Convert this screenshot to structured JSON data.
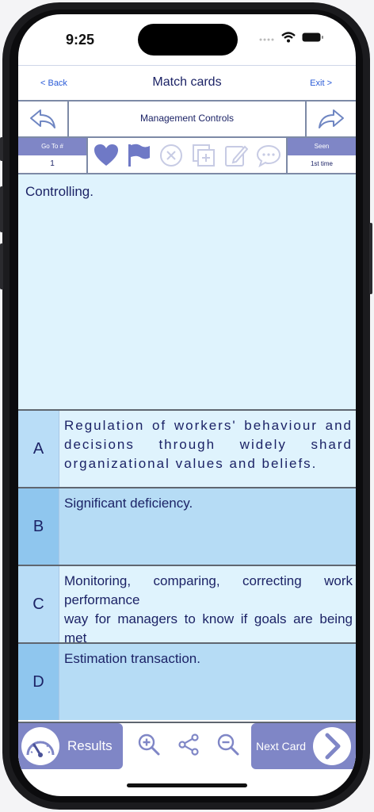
{
  "status_bar": {
    "time": "9:25"
  },
  "nav": {
    "back_label": "< Back",
    "title": "Match cards",
    "exit_label": "Exit >"
  },
  "topic": {
    "title": "Management Controls"
  },
  "goto": {
    "header": "Go To #",
    "value": "1"
  },
  "seen": {
    "header": "Seen",
    "value": "1st time"
  },
  "toolbar_icons": [
    "heart-icon",
    "flag-icon",
    "close-circle-icon",
    "add-note-icon",
    "edit-icon",
    "chat-icon"
  ],
  "question": {
    "text": "Controlling."
  },
  "answers": [
    {
      "letter": "A",
      "text": "Regulation of workers' behaviour and decisions through widely shard organizational values and beliefs."
    },
    {
      "letter": "B",
      "text": "Significant deficiency."
    },
    {
      "letter": "C",
      "text": "Monitoring, comparing, correcting work performance\n way for managers to know if goals are being met"
    },
    {
      "letter": "D",
      "text": "Estimation transaction."
    }
  ],
  "bottom": {
    "results_label": "Results",
    "next_label": "Next Card"
  },
  "colors": {
    "accent": "#7f86c6",
    "light_blue": "#dff3fd",
    "mid_blue": "#b6dcf5",
    "text": "#1c2366",
    "link": "#2a5bd7"
  }
}
